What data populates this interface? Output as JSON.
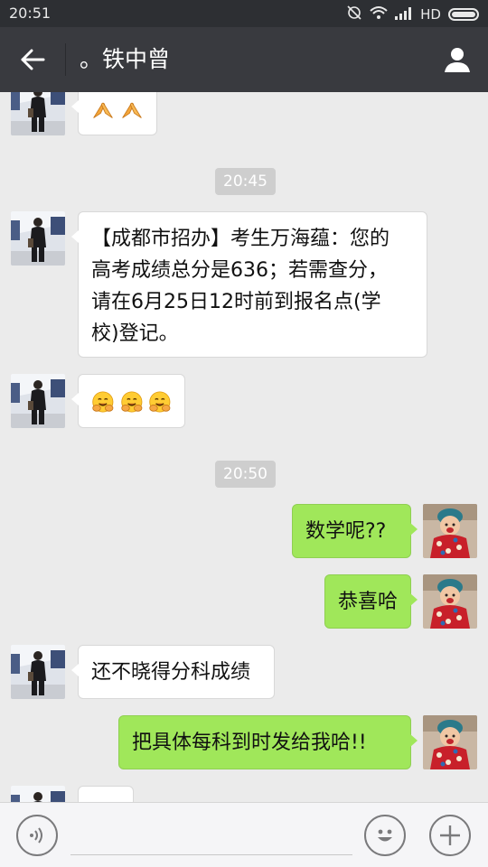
{
  "status_bar": {
    "time": "20:51",
    "network": "HD"
  },
  "header": {
    "title": "。铁中曾",
    "back_icon": "arrow-left-icon",
    "profile_icon": "person-icon"
  },
  "messages": {
    "m0": {
      "from": "them",
      "kind": "emoji",
      "emoji": [
        "praying-hands",
        "praying-hands"
      ]
    },
    "ts1": "20:45",
    "m1": {
      "from": "them",
      "lines": [
        "【成都市招办】考生万海蕴：您的",
        "高考成绩总分是636；若需查分，",
        "请在6月25日12时前到报名点(学",
        "校)登记。"
      ]
    },
    "m2": {
      "from": "them",
      "kind": "emoji",
      "emoji": [
        "hug-face",
        "hug-face",
        "hug-face"
      ]
    },
    "ts2": "20:50",
    "m3": {
      "from": "me",
      "text": "数学呢??"
    },
    "m4": {
      "from": "me",
      "text": "恭喜哈"
    },
    "m5": {
      "from": "them",
      "text": "还不晓得分科成绩"
    },
    "m6": {
      "from": "me",
      "text": "把具体每科到时发给我哈!!"
    }
  },
  "input_bar": {
    "voice_icon": "voice-icon",
    "emoji_icon": "smiley-icon",
    "plus_icon": "plus-icon",
    "value": ""
  },
  "colors": {
    "status_bar": "#2d2f33",
    "nav_bar": "#393a3f",
    "chat_bg": "#ebebeb",
    "my_bubble": "#a0e75a",
    "their_bubble": "#ffffff"
  }
}
